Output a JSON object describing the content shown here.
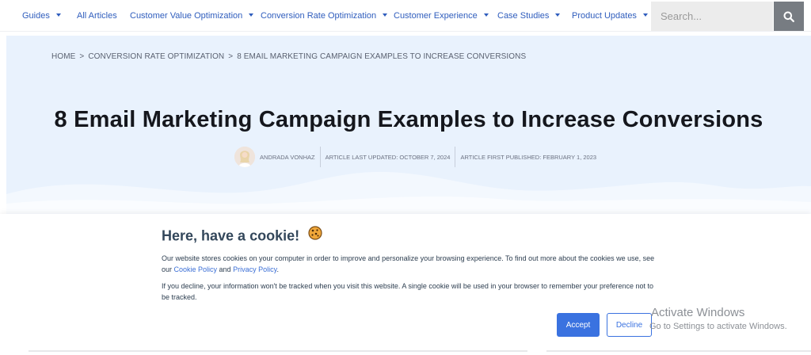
{
  "nav": {
    "items": [
      {
        "label": "Guides",
        "has_caret": true
      },
      {
        "label": "All Articles",
        "has_caret": false
      },
      {
        "label": "Customer Value Optimization",
        "has_caret": true
      },
      {
        "label": "Conversion Rate Optimization",
        "has_caret": true
      },
      {
        "label": "Customer Experience",
        "has_caret": true
      },
      {
        "label": "Case Studies",
        "has_caret": true
      },
      {
        "label": "Product Updates",
        "has_caret": true
      }
    ],
    "search_placeholder": "Search..."
  },
  "breadcrumb": {
    "home": "HOME",
    "sep": ">",
    "category": "CONVERSION RATE OPTIMIZATION",
    "current": "8 EMAIL MARKETING CAMPAIGN EXAMPLES TO INCREASE CONVERSIONS"
  },
  "article": {
    "title": "8 Email Marketing Campaign Examples to Increase Conversions",
    "author": "ANDRADA VONHAZ",
    "last_updated": "ARTICLE LAST UPDATED: OCTOBER 7, 2024",
    "first_published": "ARTICLE FIRST PUBLISHED: FEBRUARY 1, 2023"
  },
  "cookie": {
    "title": "Here, have a cookie!",
    "p1_text": "Our website stores cookies on your computer in order to improve and personalize your browsing experience. To find out more about the cookies we use, see our ",
    "cookie_policy_link": "Cookie Policy",
    "and": " and ",
    "privacy_policy_link": "Privacy Policy",
    "p1_end": ".",
    "p2_text": "If you decline, your information won't be tracked when you visit this website. A single cookie will be used in your browser to remember your preference not to be tracked.",
    "accept_label": "Accept",
    "decline_label": "Decline"
  },
  "watermark": {
    "line1": "Activate Windows",
    "line2": "Go to Settings to activate Windows."
  },
  "colors": {
    "nav_link": "#2f5dbd",
    "hero_bg": "#e9f2fd",
    "accent": "#3a72e0",
    "cookie_title": "#33475b"
  },
  "icons": {
    "search": "search-icon",
    "caret": "caret-down-icon",
    "cookie": "cookie-icon"
  }
}
